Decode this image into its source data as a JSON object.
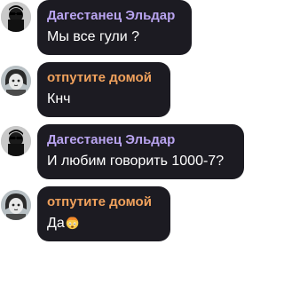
{
  "messages": [
    {
      "sender": "Дагестанец Эльдар",
      "text": "Мы все гули ?",
      "sender_color": "#b9a4f0",
      "avatar_icon": "sunglasses-avatar"
    },
    {
      "sender": "отпутите домой",
      "text": "Кнч",
      "sender_color": "#f0a15c",
      "avatar_icon": "anime-avatar"
    },
    {
      "sender": "Дагестанец Эльдар",
      "text": "И любим говорить 1000-7?",
      "sender_color": "#b9a4f0",
      "avatar_icon": "sunglasses-avatar"
    },
    {
      "sender": "отпутите домой",
      "text": "Да",
      "sender_color": "#f0a15c",
      "avatar_icon": "anime-avatar",
      "emoji": "exploding-head-emoji"
    }
  ],
  "colors": {
    "bubble": "#1c1b22",
    "message_text": "#ffffff",
    "background": "#ffffff"
  }
}
